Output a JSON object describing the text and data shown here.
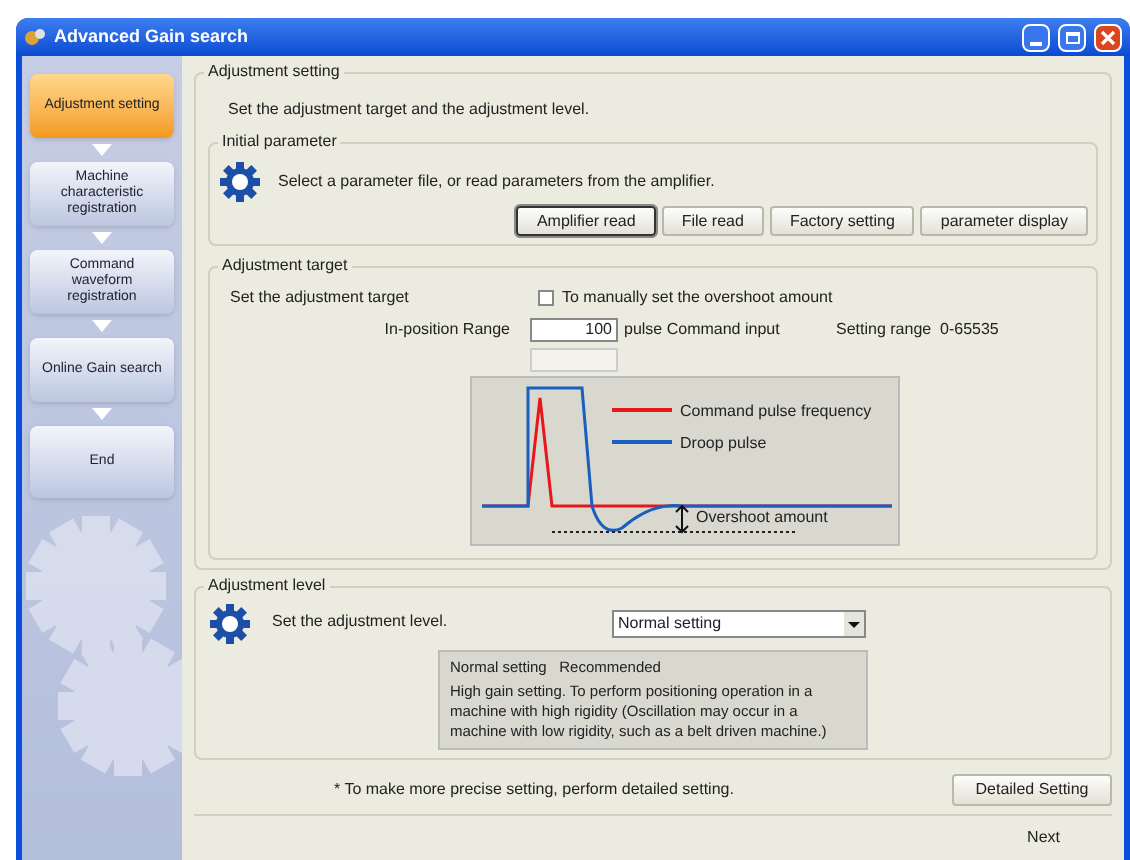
{
  "window": {
    "title": "Advanced Gain search"
  },
  "steps": [
    {
      "label": "Adjustment setting",
      "selected": true
    },
    {
      "label": "Machine characteristic registration",
      "selected": false
    },
    {
      "label": "Command waveform registration",
      "selected": false
    },
    {
      "label": "Online Gain search",
      "selected": false
    },
    {
      "label": "End",
      "selected": false
    }
  ],
  "adjustment_setting": {
    "title": "Adjustment setting",
    "description": "Set the adjustment target and the adjustment level."
  },
  "initial_parameter": {
    "title": "Initial parameter",
    "description": "Select a parameter file, or read parameters from the amplifier.",
    "buttons": [
      {
        "label": "Amplifier read",
        "selected": true
      },
      {
        "label": "File read",
        "selected": false
      },
      {
        "label": "Factory setting",
        "selected": false
      },
      {
        "label": "parameter display",
        "selected": false
      }
    ]
  },
  "adjustment_target": {
    "title": "Adjustment target",
    "description": "Set the adjustment target",
    "manual_overshoot": {
      "label": "To manually set the overshoot amount",
      "checked": false
    },
    "in_position": {
      "label": "In-position Range",
      "value": "100",
      "unit": "pulse Command input",
      "range_label": "Setting range",
      "range": "0-65535"
    },
    "overshoot_field": {
      "disabled": true
    },
    "legend": [
      "Command pulse frequency",
      "Droop pulse"
    ],
    "overshoot_label": "Overshoot amount"
  },
  "adjustment_level": {
    "title": "Adjustment level",
    "description": "Set the adjustment level.",
    "value": "Normal setting",
    "info": {
      "heading": "Normal setting   Recommended",
      "text": "High gain setting.  To perform positioning operation in a machine with high rigidity (Oscillation may occur in a machine with low rigidity, such as a belt driven machine.)"
    }
  },
  "footnote": "* To make more precise setting, perform detailed setting.",
  "detailed_button": "Detailed Setting",
  "next_button": "Next"
}
